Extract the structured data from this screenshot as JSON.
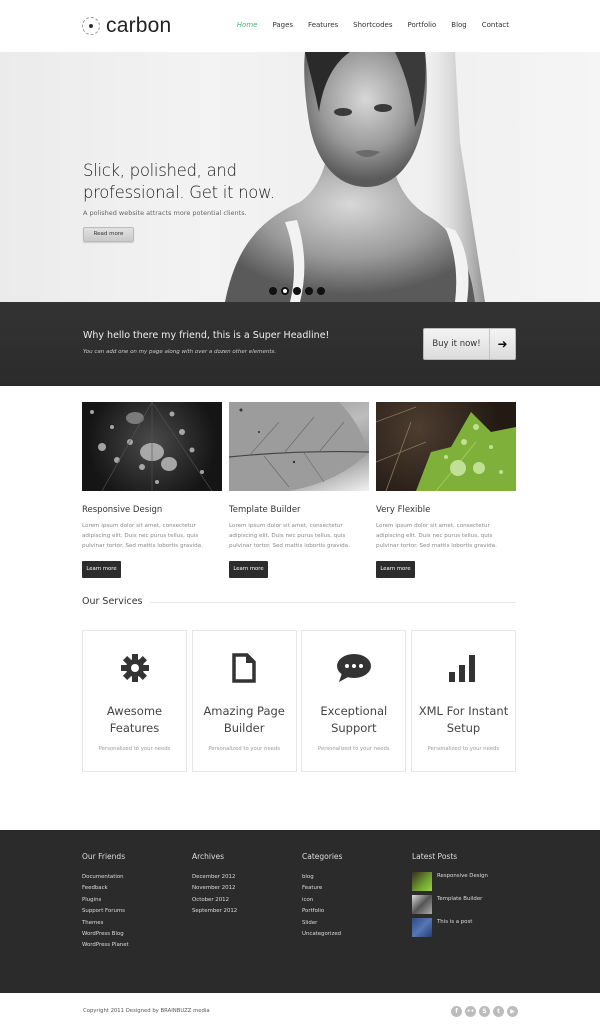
{
  "header": {
    "logo_text": "carbon",
    "nav": [
      {
        "label": "Home",
        "active": true
      },
      {
        "label": "Pages",
        "active": false
      },
      {
        "label": "Features",
        "active": false
      },
      {
        "label": "Shortcodes",
        "active": false
      },
      {
        "label": "Portfolio",
        "active": false
      },
      {
        "label": "Blog",
        "active": false
      },
      {
        "label": "Contact",
        "active": false
      }
    ],
    "accent_color": "#3cba7a"
  },
  "hero": {
    "title_line1": "Slick, polished, and",
    "title_line2": "professional. Get it now.",
    "subtitle": "A polished website attracts more potential clients.",
    "button_label": "Read more",
    "slide_count": 5,
    "active_slide": 2
  },
  "callout": {
    "title": "Why hello there my friend, this is a Super Headline!",
    "subtitle": "You can add one on my page along with over a dozen other elements.",
    "button_label": "Buy it now!",
    "button_icon": "arrow-right-icon"
  },
  "features": [
    {
      "title": "Responsive Design",
      "text": "Lorem ipsum dolor sit amet, consectetur adipiscing elit. Duis nec purus tellus, quis pulvinar tortor. Sed mattis lobortis gravida.",
      "button": "Learn more",
      "image": "water-drops-on-leaf"
    },
    {
      "title": "Template Builder",
      "text": "Lorem ipsum dolor sit amet, consectetur adipiscing elit. Duis nec purus tellus, quis pulvinar tortor. Sed mattis lobortis gravida.",
      "button": "Learn more",
      "image": "grey-leaf-texture"
    },
    {
      "title": "Very Flexible",
      "text": "Lorem ipsum dolor sit amet, consectetur adipiscing elit. Duis nec purus tellus, quis pulvinar tortor. Sed mattis lobortis gravida.",
      "button": "Learn more",
      "image": "green-leaf-with-drops"
    }
  ],
  "services": {
    "heading": "Our Services",
    "items": [
      {
        "icon": "gear-icon",
        "title_line1": "Awesome",
        "title_line2": "Features",
        "subtitle": "Personalized to your needs"
      },
      {
        "icon": "document-icon",
        "title_line1": "Amazing Page",
        "title_line2": "Builder",
        "subtitle": "Personalized to your needs"
      },
      {
        "icon": "chat-bubble-icon",
        "title_line1": "Exceptional",
        "title_line2": "Support",
        "subtitle": "Personalized to your needs"
      },
      {
        "icon": "bar-chart-icon",
        "title_line1": "XML For Instant",
        "title_line2": "Setup",
        "subtitle": "Personalized to your needs"
      }
    ]
  },
  "footer": {
    "friends": {
      "heading": "Our Friends",
      "links": [
        "Documentation",
        "Feedback",
        "Plugins",
        "Support Forums",
        "Themes",
        "WordPress Blog",
        "WordPress Planet"
      ]
    },
    "archives": {
      "heading": "Archives",
      "links": [
        "December 2012",
        "November 2012",
        "October 2012",
        "September 2012"
      ]
    },
    "categories": {
      "heading": "Categories",
      "links": [
        "blog",
        "Feature",
        "icon",
        "Portfolio",
        "Slider",
        "Uncategorized"
      ]
    },
    "latest_posts": {
      "heading": "Latest Posts",
      "posts": [
        "Responsive Design",
        "Template Builder",
        "This is a post"
      ]
    }
  },
  "bottom": {
    "copyright": "Copyright 2011 Designed by BRAINBUZZ media",
    "social": [
      {
        "name": "facebook-icon",
        "glyph": "f"
      },
      {
        "name": "flickr-icon",
        "glyph": "••"
      },
      {
        "name": "skype-icon",
        "glyph": "S"
      },
      {
        "name": "twitter-icon",
        "glyph": "t"
      },
      {
        "name": "youtube-icon",
        "glyph": "▶"
      }
    ]
  }
}
